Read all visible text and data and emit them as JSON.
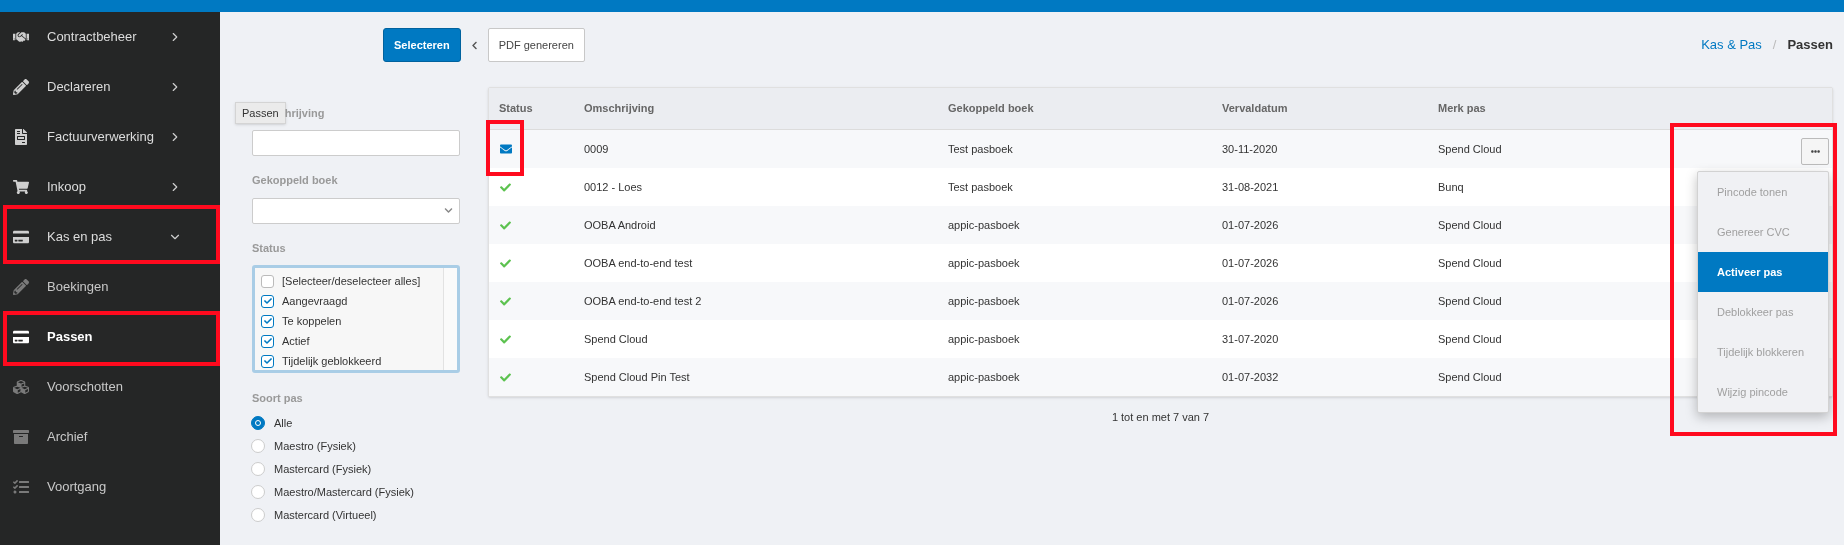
{
  "sidebar": {
    "items": [
      {
        "label": "Contractbeheer",
        "expanded": false,
        "selected": false,
        "annotated": false
      },
      {
        "label": "Declareren",
        "expanded": false,
        "selected": false,
        "annotated": false
      },
      {
        "label": "Factuurverwerking",
        "expanded": false,
        "selected": false,
        "annotated": false
      },
      {
        "label": "Inkoop",
        "expanded": false,
        "selected": false,
        "annotated": false
      },
      {
        "label": "Kas en pas",
        "expanded": true,
        "selected": false,
        "annotated": true,
        "children": [
          {
            "label": "Boekingen",
            "selected": false,
            "annotated": false
          },
          {
            "label": "Passen",
            "selected": true,
            "annotated": true
          },
          {
            "label": "Voorschotten",
            "selected": false,
            "annotated": false
          },
          {
            "label": "Archief",
            "selected": false,
            "annotated": false
          },
          {
            "label": "Voortgang",
            "selected": false,
            "annotated": false
          }
        ]
      }
    ]
  },
  "toolbar": {
    "buttons": [
      {
        "label": "Selecteren",
        "kind": "primary"
      },
      {
        "label": "PDF genereren",
        "kind": "secondary"
      }
    ]
  },
  "breadcrumb": {
    "items": [
      {
        "label": "Kas & Pas",
        "selected": false
      },
      {
        "label": "Passen",
        "selected": true
      }
    ],
    "separator": "/"
  },
  "tooltip": "Passen",
  "filters": {
    "description": {
      "label": "hrijving"
    },
    "linked_book": {
      "label": "Gekoppeld boek"
    },
    "status": {
      "label": "Status",
      "options": [
        {
          "label": "[Selecteer/deselecteer alles]",
          "checked": false
        },
        {
          "label": "Aangevraagd",
          "checked": true
        },
        {
          "label": "Te koppelen",
          "checked": true
        },
        {
          "label": "Actief",
          "checked": true
        },
        {
          "label": "Tijdelijk geblokkeerd",
          "checked": true
        }
      ]
    },
    "card_type": {
      "label": "Soort pas",
      "options": [
        {
          "label": "Alle",
          "selected": true
        },
        {
          "label": "Maestro (Fysiek)",
          "selected": false
        },
        {
          "label": "Mastercard (Fysiek)",
          "selected": false
        },
        {
          "label": "Maestro/Mastercard (Fysiek)",
          "selected": false
        },
        {
          "label": "Mastercard (Virtueel)",
          "selected": false
        }
      ]
    }
  },
  "table": {
    "columns": [
      "Status",
      "Omschrijving",
      "Gekoppeld boek",
      "Vervaldatum",
      "Merk pas"
    ],
    "rows": [
      {
        "kind": "mail",
        "annotated": true,
        "cells": [
          "",
          "0009",
          "Test pasboek",
          "30-11-2020",
          "Spend Cloud"
        ]
      },
      {
        "kind": "ok",
        "annotated": false,
        "cells": [
          "",
          "0012 - Loes",
          "Test pasboek",
          "31-08-2021",
          "Bunq"
        ]
      },
      {
        "kind": "ok",
        "annotated": false,
        "cells": [
          "",
          "OOBA Android",
          "appic-pasboek",
          "01-07-2026",
          "Spend Cloud"
        ]
      },
      {
        "kind": "ok",
        "annotated": false,
        "cells": [
          "",
          "OOBA end-to-end test",
          "appic-pasboek",
          "01-07-2026",
          "Spend Cloud"
        ]
      },
      {
        "kind": "ok",
        "annotated": false,
        "cells": [
          "",
          "OOBA end-to-end test 2",
          "appic-pasboek",
          "01-07-2026",
          "Spend Cloud"
        ]
      },
      {
        "kind": "ok",
        "annotated": false,
        "cells": [
          "",
          "Spend Cloud",
          "appic-pasboek",
          "31-07-2020",
          "Spend Cloud"
        ]
      },
      {
        "kind": "ok",
        "annotated": false,
        "cells": [
          "",
          "Spend Cloud Pin Test",
          "appic-pasboek",
          "01-07-2032",
          "Spend Cloud"
        ]
      }
    ],
    "footer": "1 tot en met 7 van 7"
  },
  "actions_menu": {
    "annotated": true,
    "items": [
      {
        "label": "Pincode tonen",
        "selected": false,
        "disabled": true
      },
      {
        "label": "Genereer CVC",
        "selected": false,
        "disabled": true
      },
      {
        "label": "Activeer pas",
        "selected": true,
        "disabled": false
      },
      {
        "label": "Deblokkeer pas",
        "selected": false,
        "disabled": true
      },
      {
        "label": "Tijdelijk blokkeren",
        "selected": false,
        "disabled": true
      },
      {
        "label": "Wijzig pincode",
        "selected": false,
        "disabled": true
      }
    ]
  }
}
